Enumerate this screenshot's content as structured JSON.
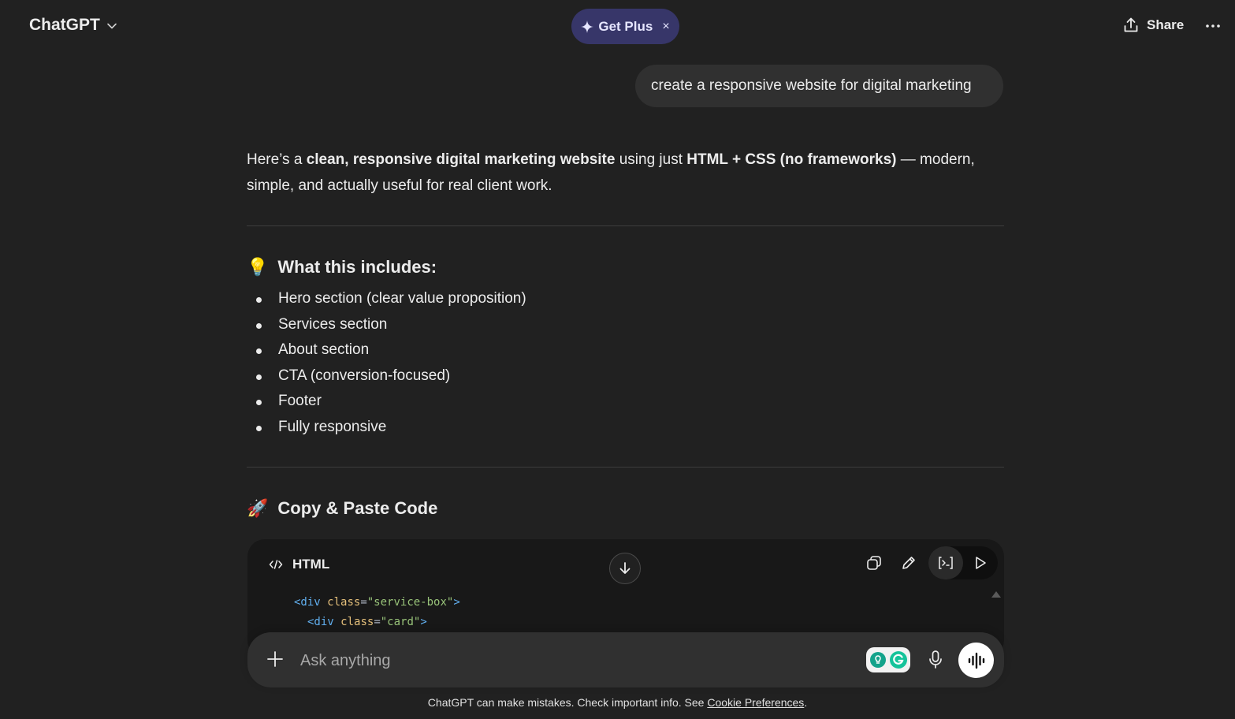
{
  "header": {
    "brand": "ChatGPT",
    "get_plus_label": "Get Plus",
    "get_plus_close": "×",
    "share_label": "Share"
  },
  "conversation": {
    "user_message": "create a responsive website for digital marketing",
    "intro": {
      "p1": "Here’s a ",
      "b1": "clean, responsive digital marketing website",
      "p2": " using just ",
      "b2": "HTML + CSS (no frameworks)",
      "p3": " — modern, simple, and actually useful for real client work."
    },
    "section1": {
      "emoji": "💡",
      "title": "What this includes:",
      "items": [
        "Hero section (clear value proposition)",
        "Services section",
        "About section",
        "CTA (conversion-focused)",
        "Footer",
        "Fully responsive"
      ]
    },
    "section2": {
      "emoji": "🚀",
      "title": "Copy & Paste Code"
    },
    "code_block": {
      "language": "HTML",
      "lines": [
        {
          "tag_open": "<div",
          "attr": "class",
          "eq": "=",
          "value": "\"service-box\"",
          "tag_close": ">"
        },
        {
          "tag_open": "<div",
          "attr": "class",
          "eq": "=",
          "value": "\"card\"",
          "tag_close": ">"
        }
      ]
    }
  },
  "composer": {
    "placeholder": "Ask anything"
  },
  "footer": {
    "disclaimer": "ChatGPT can make mistakes. Check important info. See ",
    "link": "Cookie Preferences",
    "end": "."
  },
  "colors": {
    "background": "#212121",
    "get_plus_bg": "#373669",
    "bubble_bg": "#303030",
    "code_bg": "#181818"
  },
  "icons": {
    "brand_chevron": "chevron-down-icon",
    "sparkle": "sparkle-icon",
    "share": "share-upload-icon",
    "more": "more-horizontal-icon",
    "code": "code-icon",
    "copy": "copy-icon",
    "edit": "pencil-icon",
    "canvas": "canvas-icon",
    "run": "play-icon",
    "scroll_down": "arrow-down-icon",
    "attach": "plus-icon",
    "mic": "mic-icon",
    "voice": "voice-mode-icon",
    "extension": "grammarly-icon"
  }
}
